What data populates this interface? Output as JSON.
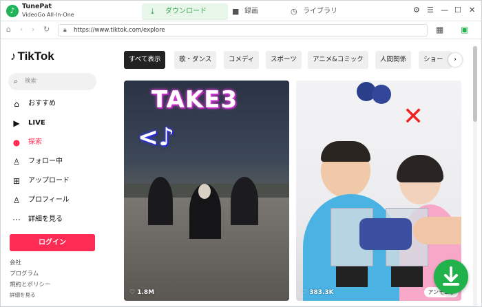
{
  "app": {
    "name": "TunePat",
    "subtitle": "VideoGo All-In-One"
  },
  "tabs": [
    {
      "label": "ダウンロード",
      "active": true
    },
    {
      "label": "録画",
      "active": false
    },
    {
      "label": "ライブラリ",
      "active": false
    }
  ],
  "address_bar": {
    "url": "https://www.tiktok.com/explore"
  },
  "sidebar": {
    "brand": "TikTok",
    "search_placeholder": "検索",
    "nav": [
      {
        "label": "おすすめ",
        "icon": "home-icon",
        "active": false
      },
      {
        "label": "LIVE",
        "icon": "live-icon",
        "active": false
      },
      {
        "label": "探索",
        "icon": "compass-icon",
        "active": true
      },
      {
        "label": "フォロー中",
        "icon": "following-icon",
        "active": false
      },
      {
        "label": "アップロード",
        "icon": "upload-icon",
        "active": false
      },
      {
        "label": "プロフィール",
        "icon": "profile-icon",
        "active": false
      },
      {
        "label": "詳細を見る",
        "icon": "more-icon",
        "active": false
      }
    ],
    "login_label": "ログイン",
    "footer": [
      "会社",
      "プログラム",
      "規約とポリシー",
      "詳細を見る"
    ]
  },
  "categories": [
    "すべて表示",
    "歌・ダンス",
    "コメディ",
    "スポーツ",
    "アニメ&コミック",
    "人間関係",
    "ショー"
  ],
  "videos": [
    {
      "overlay_text": "TAKE3",
      "overlay_symbol": "<♪",
      "views": "1.8M"
    },
    {
      "overlay_symbol": "✕",
      "views": "383.3K",
      "badge": "アンモニ手"
    }
  ],
  "colors": {
    "accent_green": "#21b24c",
    "tiktok_red": "#fe2c55",
    "active_tab_bg": "#e8f6ea"
  }
}
